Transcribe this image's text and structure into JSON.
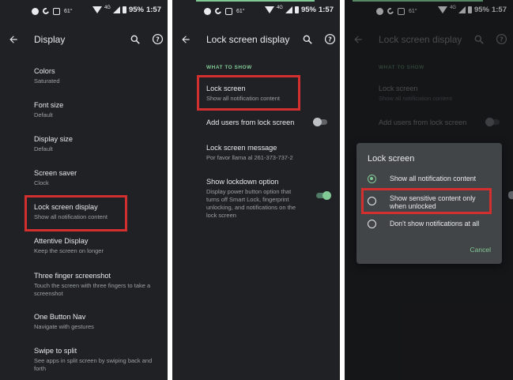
{
  "status": {
    "temp": "61°",
    "signal_label": "4G",
    "battery": "95%",
    "time": "1:57"
  },
  "colors": {
    "accent": "#81c995",
    "highlight": "#d32f2f",
    "background": "#202124",
    "dialog": "#424548"
  },
  "panel1": {
    "title": "Display",
    "items": [
      {
        "title": "Colors",
        "sub": "Saturated"
      },
      {
        "title": "Font size",
        "sub": "Default"
      },
      {
        "title": "Display size",
        "sub": "Default"
      },
      {
        "title": "Screen saver",
        "sub": "Clock"
      },
      {
        "title": "Lock screen display",
        "sub": "Show all notification content"
      },
      {
        "title": "Attentive Display",
        "sub": "Keep the screen on longer"
      },
      {
        "title": "Three finger screenshot",
        "sub": "Touch the screen with three fingers to take a screenshot"
      },
      {
        "title": "One Button Nav",
        "sub": "Navigate with gestures"
      },
      {
        "title": "Swipe to split",
        "sub": "See apps in split screen by swiping back and forth"
      }
    ]
  },
  "panel2": {
    "title": "Lock screen display",
    "section": "WHAT TO SHOW",
    "lock_screen": {
      "title": "Lock screen",
      "sub": "Show all notification content"
    },
    "add_users": {
      "title": "Add users from lock screen",
      "toggle": "off"
    },
    "message": {
      "title": "Lock screen message",
      "sub": "Por favor llama al 261-373-737-2"
    },
    "lockdown": {
      "title": "Show lockdown option",
      "sub": "Display power button option that turns off Smart Lock, fingerprint unlocking, and notifications on the lock screen",
      "toggle": "on"
    }
  },
  "panel3": {
    "title": "Lock screen display",
    "section": "WHAT TO SHOW",
    "lock_screen": {
      "title": "Lock screen",
      "sub": "Show all notification content"
    },
    "add_users": {
      "title": "Add users from lock screen"
    },
    "dialog": {
      "title": "Lock screen",
      "options": [
        {
          "label": "Show all notification content",
          "selected": true
        },
        {
          "label": "Show sensitive content only when unlocked",
          "selected": false
        },
        {
          "label": "Don't show notifications at all",
          "selected": false
        }
      ],
      "cancel_label": "Cancel"
    }
  },
  "icons": {
    "back": "arrow-back-icon",
    "search": "search-icon",
    "help": "help-icon"
  }
}
